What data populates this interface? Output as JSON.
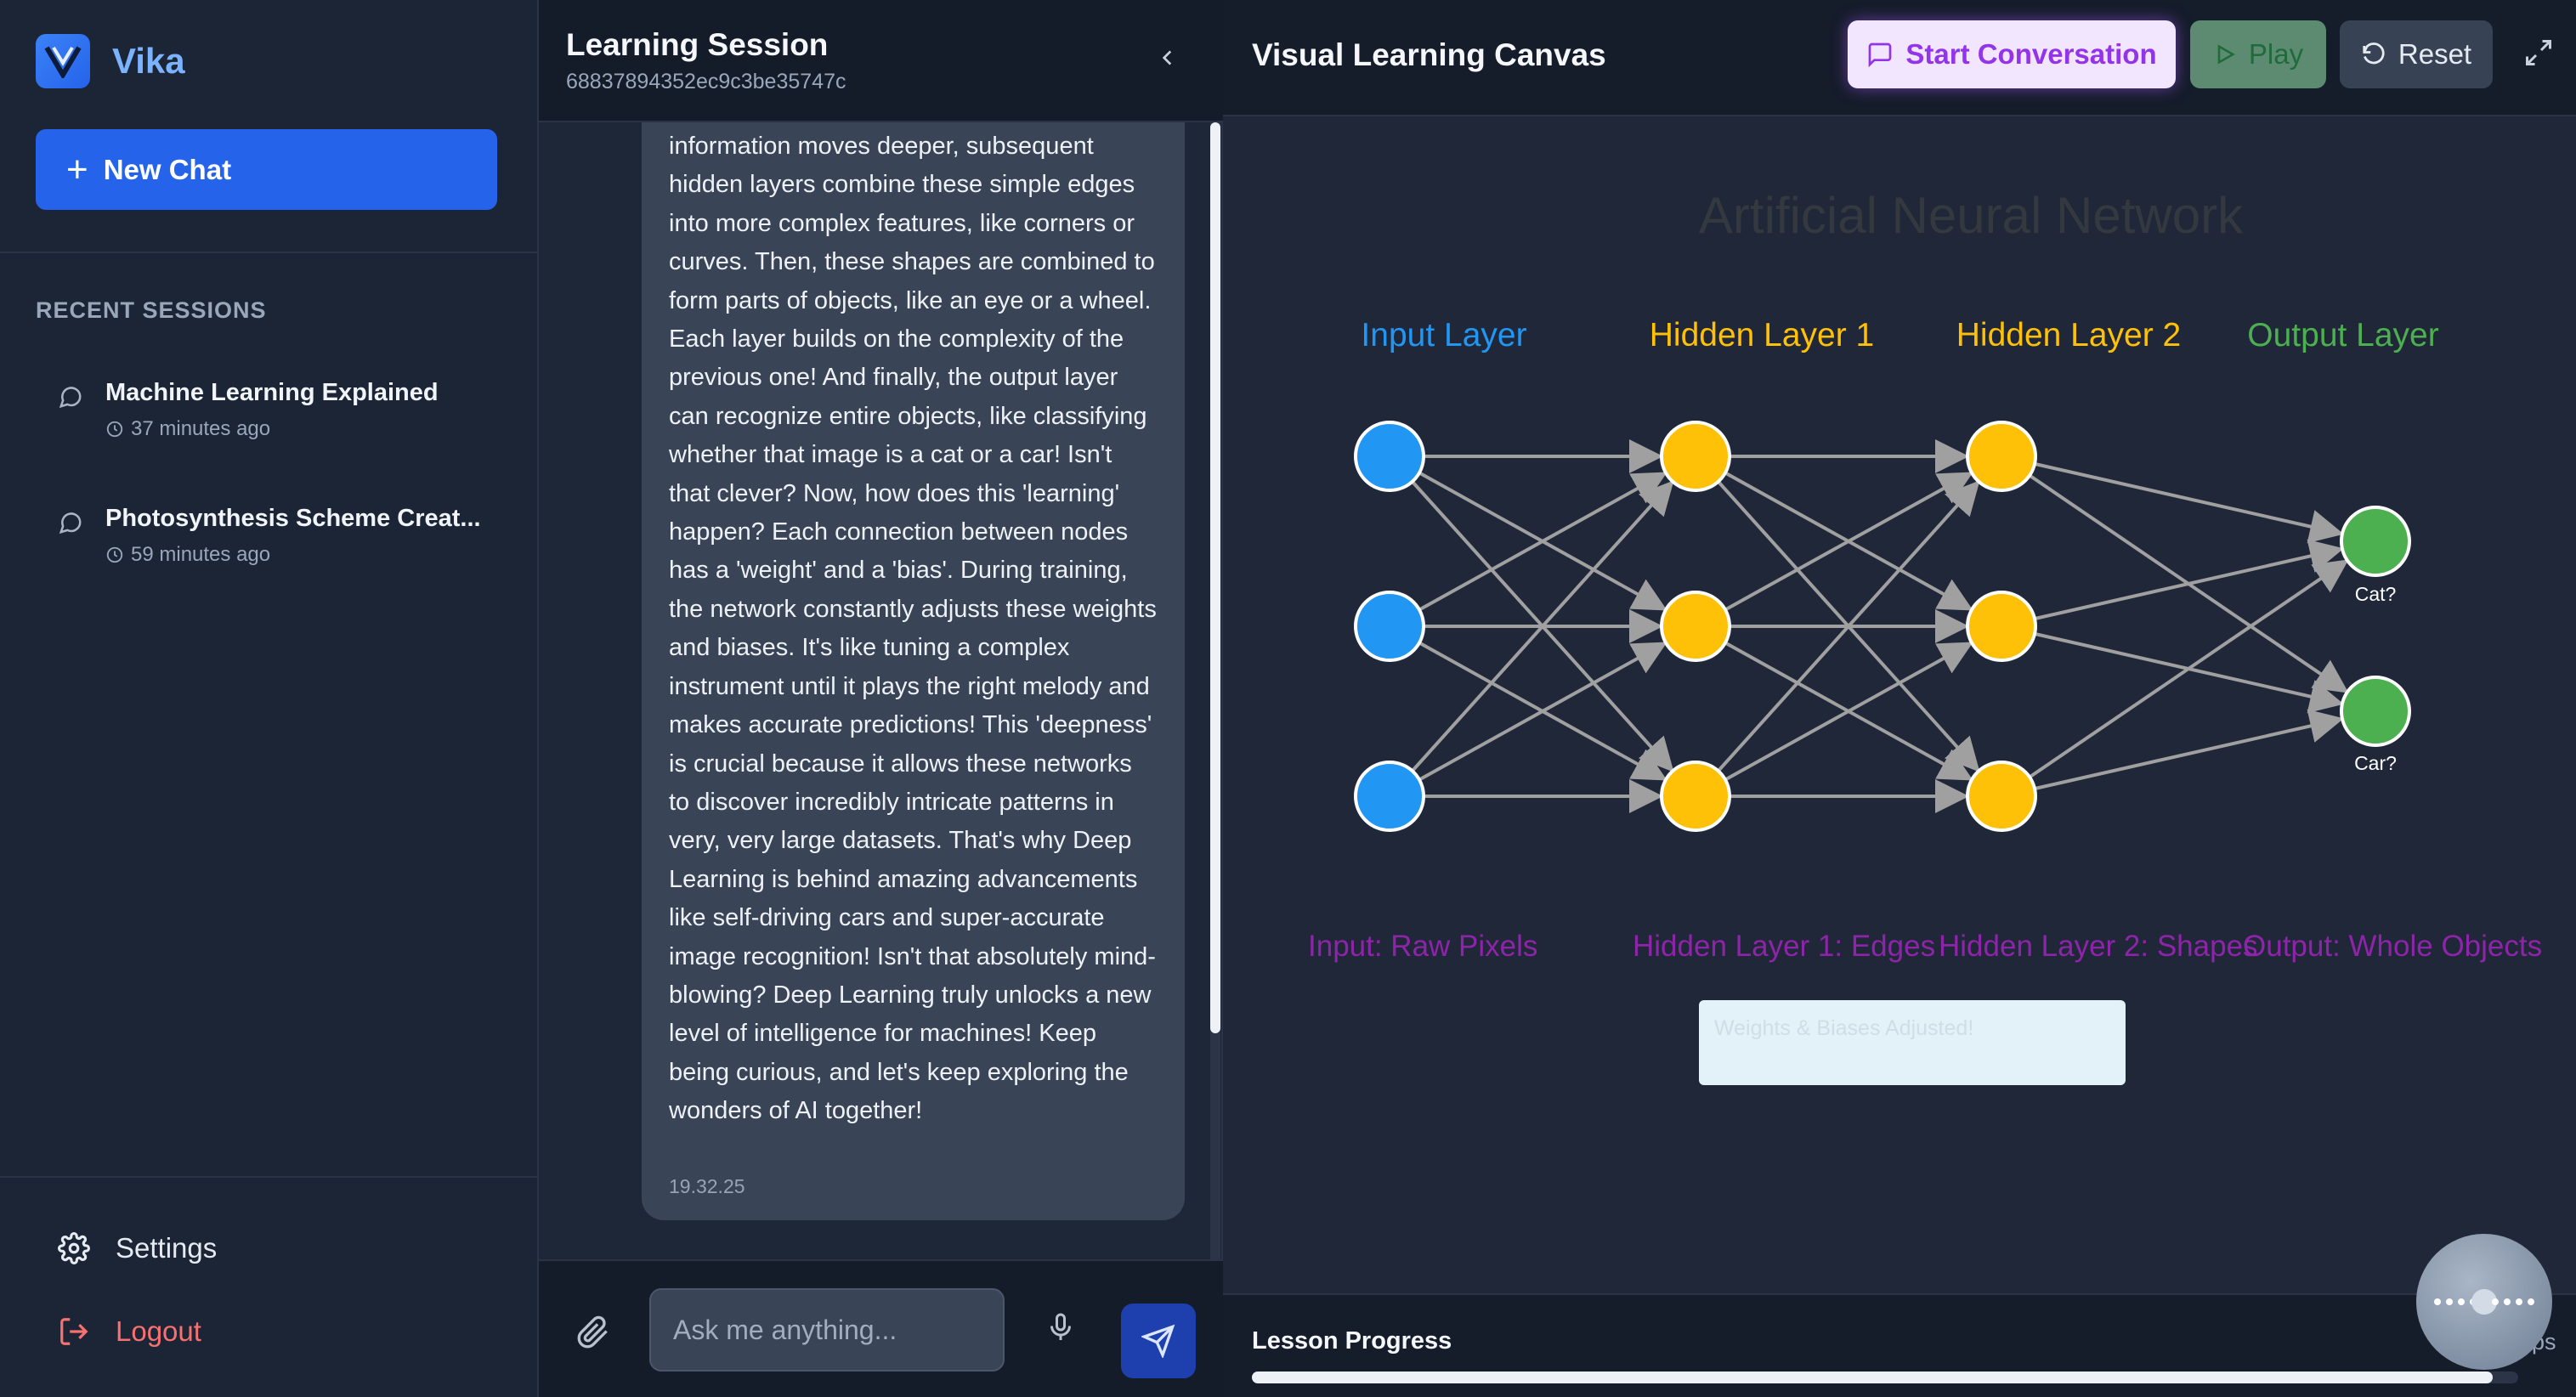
{
  "sidebar": {
    "brand": "Vika",
    "new_chat": "New Chat",
    "recent_title": "RECENT SESSIONS",
    "sessions": [
      {
        "title": "Machine Learning Explained",
        "time": "37 minutes ago"
      },
      {
        "title": "Photosynthesis Scheme Creat...",
        "time": "59 minutes ago"
      }
    ],
    "settings": "Settings",
    "logout": "Logout"
  },
  "chat": {
    "title": "Learning Session",
    "session_id": "68837894352ec9c3be35747c",
    "message": "information moves deeper, subsequent hidden layers combine these simple edges into more complex features, like corners or curves. Then, these shapes are combined to form parts of objects, like an eye or a wheel. Each layer builds on the complexity of the previous one! And finally, the output layer can recognize entire objects, like classifying whether that image is a cat or a car! Isn't that clever? Now, how does this 'learning' happen? Each connection between nodes has a 'weight' and a 'bias'. During training, the network constantly adjusts these weights and biases. It's like tuning a complex instrument until it plays the right melody and makes accurate predictions! This 'deepness' is crucial because it allows these networks to discover incredibly intricate patterns in very, very large datasets. That's why Deep Learning is behind amazing advancements like self-driving cars and super-accurate image recognition! Isn't that absolutely mind-blowing? Deep Learning truly unlocks a new level of intelligence for machines! Keep being curious, and let's keep exploring the wonders of AI together!",
    "message_time": "19.32.25",
    "input_placeholder": "Ask me anything..."
  },
  "canvas": {
    "title": "Visual Learning Canvas",
    "start_label": "Start Conversation",
    "play_label": "Play",
    "reset_label": "Reset",
    "diagram_title": "Artificial Neural Network",
    "layers": [
      {
        "name": "Input Layer",
        "caption": "Input: Raw Pixels",
        "color": "#2196f3",
        "nodes": 3
      },
      {
        "name": "Hidden Layer 1",
        "caption": "Hidden Layer 1: Edges",
        "color": "#ffc107",
        "nodes": 3
      },
      {
        "name": "Hidden Layer 2",
        "caption": "Hidden Layer 2: Shapes",
        "color": "#ffc107",
        "nodes": 3
      },
      {
        "name": "Output Layer",
        "caption": "Output: Whole Objects",
        "color": "#4caf50",
        "nodes": 2
      }
    ],
    "layer_name_colors": [
      "#2196f3",
      "#ffc107",
      "#ffc107",
      "#4caf50"
    ],
    "caption_color": "#8e24aa",
    "output_labels": [
      "Cat?",
      "Car?"
    ],
    "weights_note": "Weights & Biases Adjusted!",
    "progress_label": "Lesson Progress",
    "progress_steps": "ps",
    "progress_fraction": 0.98
  },
  "colors": {
    "accent": "#2563eb",
    "logout": "#f87171",
    "connection": "#a0a0a0"
  }
}
